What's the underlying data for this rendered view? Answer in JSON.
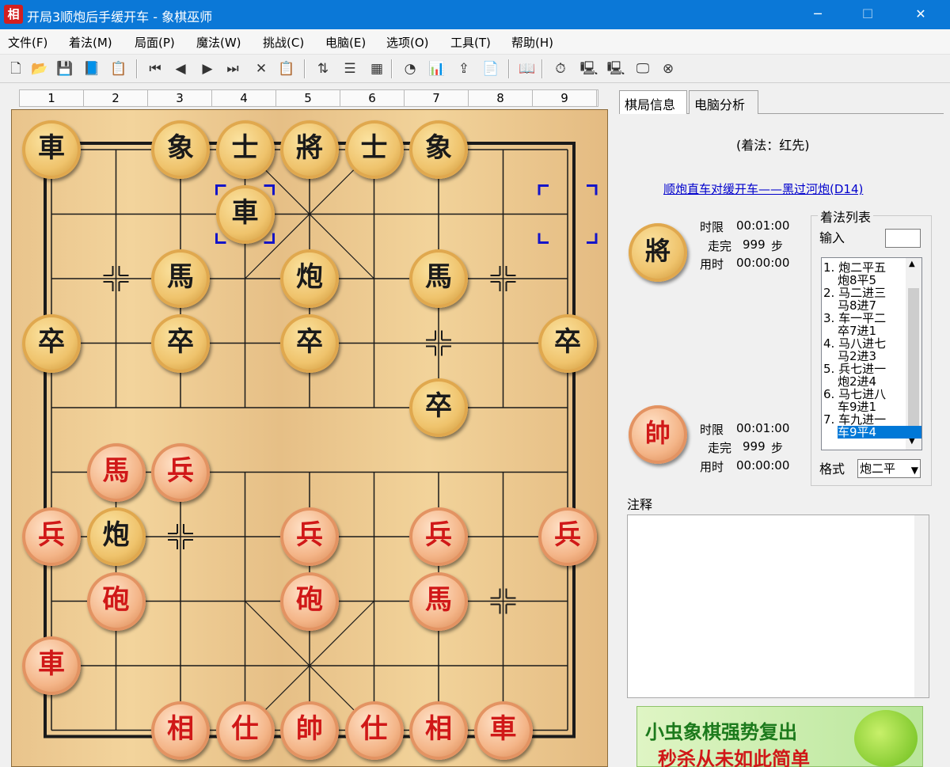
{
  "window": {
    "icon_char": "相",
    "title": "开局3顺炮后手缓开车 - 象棋巫师",
    "minimize": "─",
    "maximize": "☐",
    "close": "✕"
  },
  "menu": [
    "文件(F)",
    "着法(M)",
    "局面(P)",
    "魔法(W)",
    "挑战(C)",
    "电脑(E)",
    "选项(O)",
    "工具(T)",
    "帮助(H)"
  ],
  "toolbar": {
    "icons": [
      "new-file-icon",
      "open-folder-icon",
      "save-icon",
      "book-icon",
      "properties-icon",
      "first-move-icon",
      "prev-move-icon",
      "next-move-icon",
      "last-move-icon",
      "delete-icon",
      "paste-icon",
      "flip-icon",
      "tree-icon",
      "grid-icon",
      "color-wheel-icon",
      "search-chart-icon",
      "export-icon",
      "clipboard-icon",
      "library-icon",
      "clock-icon",
      "computer-icon",
      "computer2-icon",
      "monitor-icon",
      "stop-icon"
    ],
    "glyphs": [
      "🗋",
      "📂",
      "💾",
      "📘",
      "📋",
      "⏮",
      "◀",
      "▶",
      "⏭",
      "✕",
      "📋",
      "⇅",
      "☰",
      "▦",
      "◔",
      "📊",
      "⇪",
      "📄",
      "📖",
      "⏱",
      "🖳",
      "🖳",
      "🖵",
      "⊗"
    ]
  },
  "ruler": [
    "1",
    "2",
    "3",
    "4",
    "5",
    "6",
    "7",
    "8",
    "9"
  ],
  "board": {
    "pieces": [
      {
        "char": "車",
        "side": "black",
        "file": 0,
        "rank": 0
      },
      {
        "char": "象",
        "side": "black",
        "file": 2,
        "rank": 0
      },
      {
        "char": "士",
        "side": "black",
        "file": 3,
        "rank": 0
      },
      {
        "char": "將",
        "side": "black",
        "file": 4,
        "rank": 0
      },
      {
        "char": "士",
        "side": "black",
        "file": 5,
        "rank": 0
      },
      {
        "char": "象",
        "side": "black",
        "file": 6,
        "rank": 0
      },
      {
        "char": "車",
        "side": "black",
        "file": 3,
        "rank": 1
      },
      {
        "char": "馬",
        "side": "black",
        "file": 2,
        "rank": 2
      },
      {
        "char": "炮",
        "side": "black",
        "file": 4,
        "rank": 2
      },
      {
        "char": "馬",
        "side": "black",
        "file": 6,
        "rank": 2
      },
      {
        "char": "卒",
        "side": "black",
        "file": 0,
        "rank": 3
      },
      {
        "char": "卒",
        "side": "black",
        "file": 2,
        "rank": 3
      },
      {
        "char": "卒",
        "side": "black",
        "file": 4,
        "rank": 3
      },
      {
        "char": "卒",
        "side": "black",
        "file": 8,
        "rank": 3
      },
      {
        "char": "卒",
        "side": "black",
        "file": 6,
        "rank": 4
      },
      {
        "char": "馬",
        "side": "red",
        "file": 1,
        "rank": 5
      },
      {
        "char": "兵",
        "side": "red",
        "file": 2,
        "rank": 5
      },
      {
        "char": "兵",
        "side": "red",
        "file": 0,
        "rank": 6
      },
      {
        "char": "炮",
        "side": "black",
        "file": 1,
        "rank": 6
      },
      {
        "char": "兵",
        "side": "red",
        "file": 4,
        "rank": 6
      },
      {
        "char": "兵",
        "side": "red",
        "file": 6,
        "rank": 6
      },
      {
        "char": "兵",
        "side": "red",
        "file": 8,
        "rank": 6
      },
      {
        "char": "砲",
        "side": "red",
        "file": 1,
        "rank": 7
      },
      {
        "char": "砲",
        "side": "red",
        "file": 4,
        "rank": 7
      },
      {
        "char": "馬",
        "side": "red",
        "file": 6,
        "rank": 7
      },
      {
        "char": "車",
        "side": "red",
        "file": 0,
        "rank": 8
      },
      {
        "char": "相",
        "side": "red",
        "file": 2,
        "rank": 9
      },
      {
        "char": "仕",
        "side": "red",
        "file": 3,
        "rank": 9
      },
      {
        "char": "帥",
        "side": "red",
        "file": 4,
        "rank": 9
      },
      {
        "char": "仕",
        "side": "red",
        "file": 5,
        "rank": 9
      },
      {
        "char": "相",
        "side": "red",
        "file": 6,
        "rank": 9
      },
      {
        "char": "車",
        "side": "red",
        "file": 7,
        "rank": 9
      }
    ],
    "last_move_from": {
      "file": 8,
      "rank": 1
    },
    "last_move_to": {
      "file": 3,
      "rank": 1
    }
  },
  "tabs": [
    "棋局信息",
    "电脑分析"
  ],
  "info": {
    "move_header": "(着法：红先)",
    "opening_link": "顺炮直车对缓开车——黑过河炮(D14)",
    "black_player": {
      "piece": "將",
      "time_limit_label": "时限",
      "time_limit": "00:01:00",
      "moves_label": "走完",
      "moves": "999",
      "steps_label": "步",
      "used_label": "用时",
      "used": "00:00:00"
    },
    "red_player": {
      "piece": "帥",
      "time_limit_label": "时限",
      "time_limit": "00:01:00",
      "moves_label": "走完",
      "moves": "999",
      "steps_label": "步",
      "used_label": "用时",
      "used": "00:00:00"
    }
  },
  "movelist": {
    "title": "着法列表",
    "input_label": "输入",
    "items": [
      "1. 炮二平五",
      "炮8平5",
      "2. 马二进三",
      "马8进7",
      "3. 车一平二",
      "卒7进1",
      "4. 马八进七",
      "马2进3",
      "5. 兵七进一",
      "炮2进4",
      "6. 马七进八",
      "车9进1",
      "7. 车九进一",
      "车9平4"
    ],
    "selected_index": 13,
    "format_label": "格式",
    "format_value": "炮二平"
  },
  "notes": {
    "label": "注释",
    "content": ""
  },
  "ad": {
    "line1": "小虫象棋强势复出",
    "line2": "秒杀从未如此简单"
  }
}
